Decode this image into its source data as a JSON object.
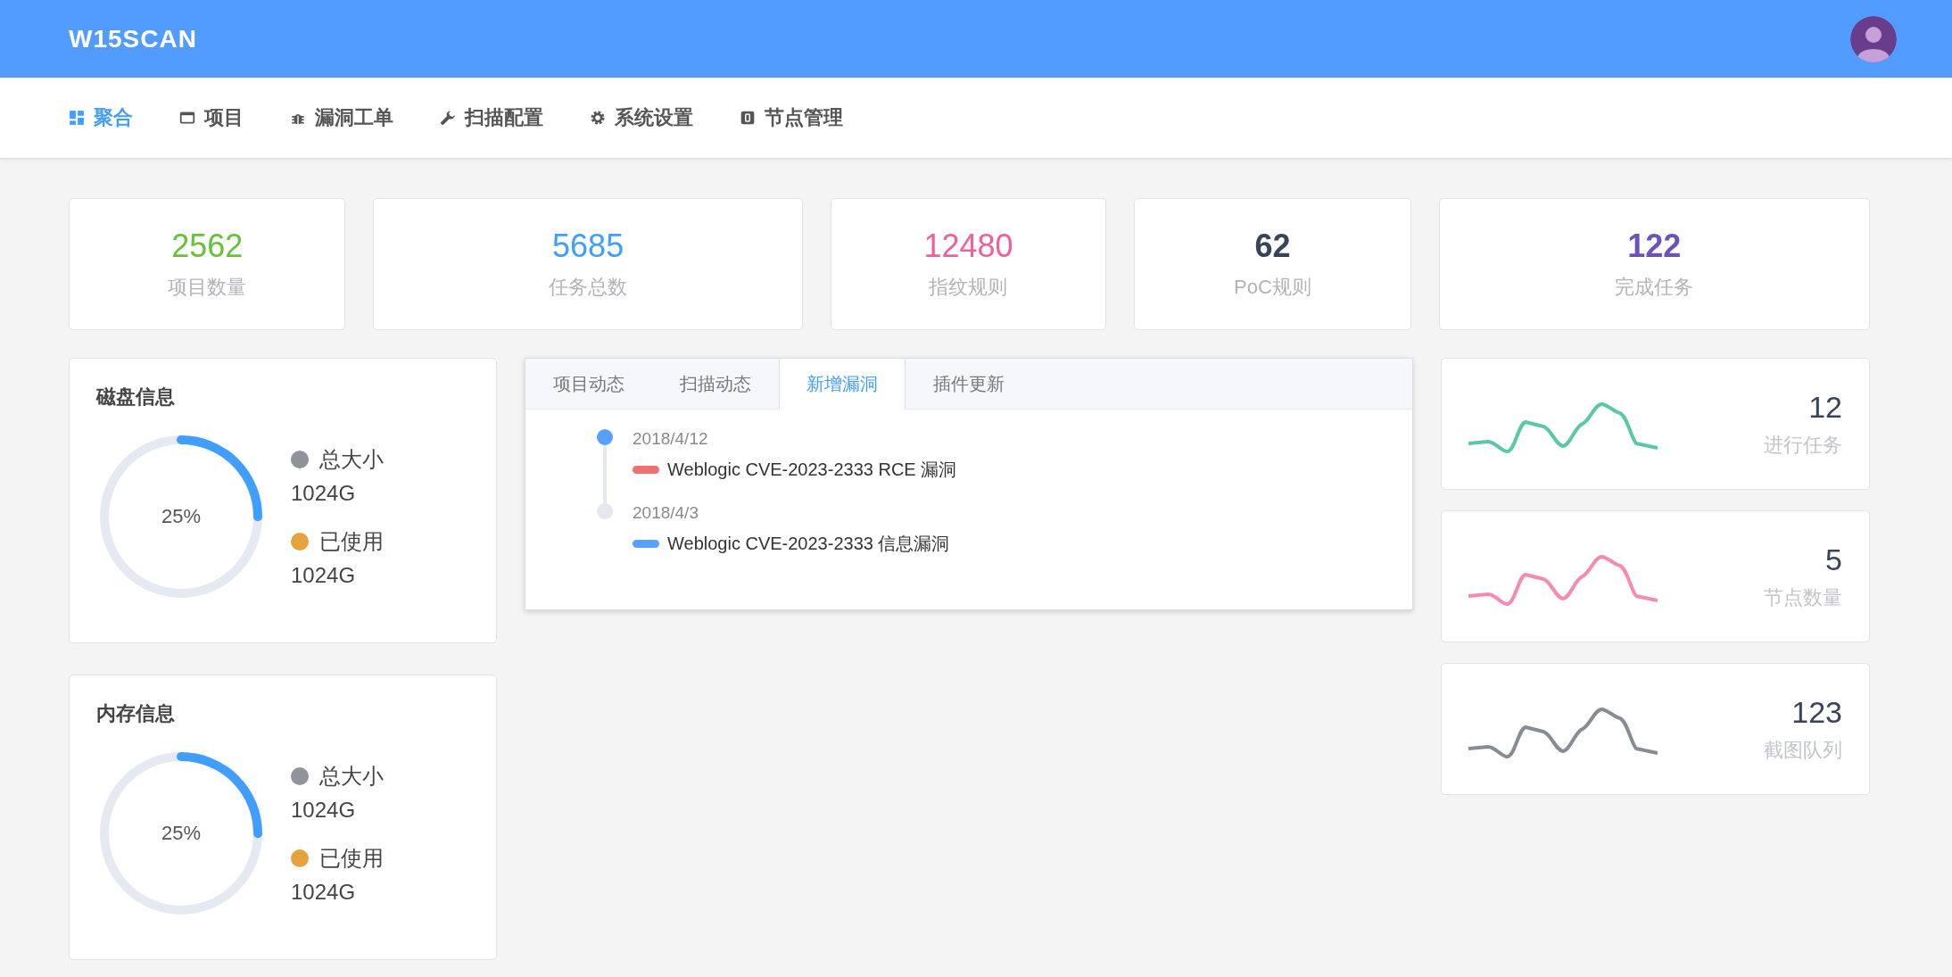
{
  "header": {
    "logo": "W15SCAN"
  },
  "nav": [
    {
      "label": "聚合",
      "selected": true
    },
    {
      "label": "项目",
      "selected": false
    },
    {
      "label": "漏洞工单",
      "selected": false
    },
    {
      "label": "扫描配置",
      "selected": false
    },
    {
      "label": "系统设置",
      "selected": false
    },
    {
      "label": "节点管理",
      "selected": false
    }
  ],
  "stats": [
    {
      "value": "2562",
      "label": "项目数量",
      "color": "#67c23a",
      "bold": false
    },
    {
      "value": "5685",
      "label": "任务总数",
      "color": "#409eff",
      "bold": false
    },
    {
      "value": "12480",
      "label": "指纹规则",
      "color": "#f0609a",
      "bold": false
    },
    {
      "value": "62",
      "label": "PoC规则",
      "color": "#3a4458",
      "bold": true
    },
    {
      "value": "122",
      "label": "完成任务",
      "color": "#6f52b8",
      "bold": true
    }
  ],
  "resources": [
    {
      "title": "磁盘信息",
      "percent": "25%",
      "level": 0.25,
      "legend": [
        {
          "label": "总大小",
          "value": "1024G",
          "color": "#909399"
        },
        {
          "label": "已使用",
          "value": "1024G",
          "color": "#e6a23c"
        }
      ]
    },
    {
      "title": "内存信息",
      "percent": "25%",
      "level": 0.25,
      "legend": [
        {
          "label": "总大小",
          "value": "1024G",
          "color": "#909399"
        },
        {
          "label": "已使用",
          "value": "1024G",
          "color": "#e6a23c"
        }
      ]
    }
  ],
  "activity": {
    "tabs": [
      {
        "label": "项目动态",
        "selected": false
      },
      {
        "label": "扫描动态",
        "selected": false
      },
      {
        "label": "新增漏洞",
        "selected": true
      },
      {
        "label": "插件更新",
        "selected": false
      }
    ],
    "timeline": [
      {
        "date": "2018/4/12",
        "title": "Weblogic CVE-2023-2333 RCE 漏洞",
        "active": true,
        "color": "#f07070"
      },
      {
        "date": "2018/4/3",
        "title": "Weblogic CVE-2023-2333 信息漏洞",
        "active": false,
        "color": "#58a0ff"
      }
    ]
  },
  "metrics": [
    {
      "value": "12",
      "label": "进行任务",
      "color": "#5ac8a8"
    },
    {
      "value": "5",
      "label": "节点数量",
      "color": "#f58bb0"
    },
    {
      "value": "123",
      "label": "截图队列",
      "color": "#868c96"
    }
  ]
}
